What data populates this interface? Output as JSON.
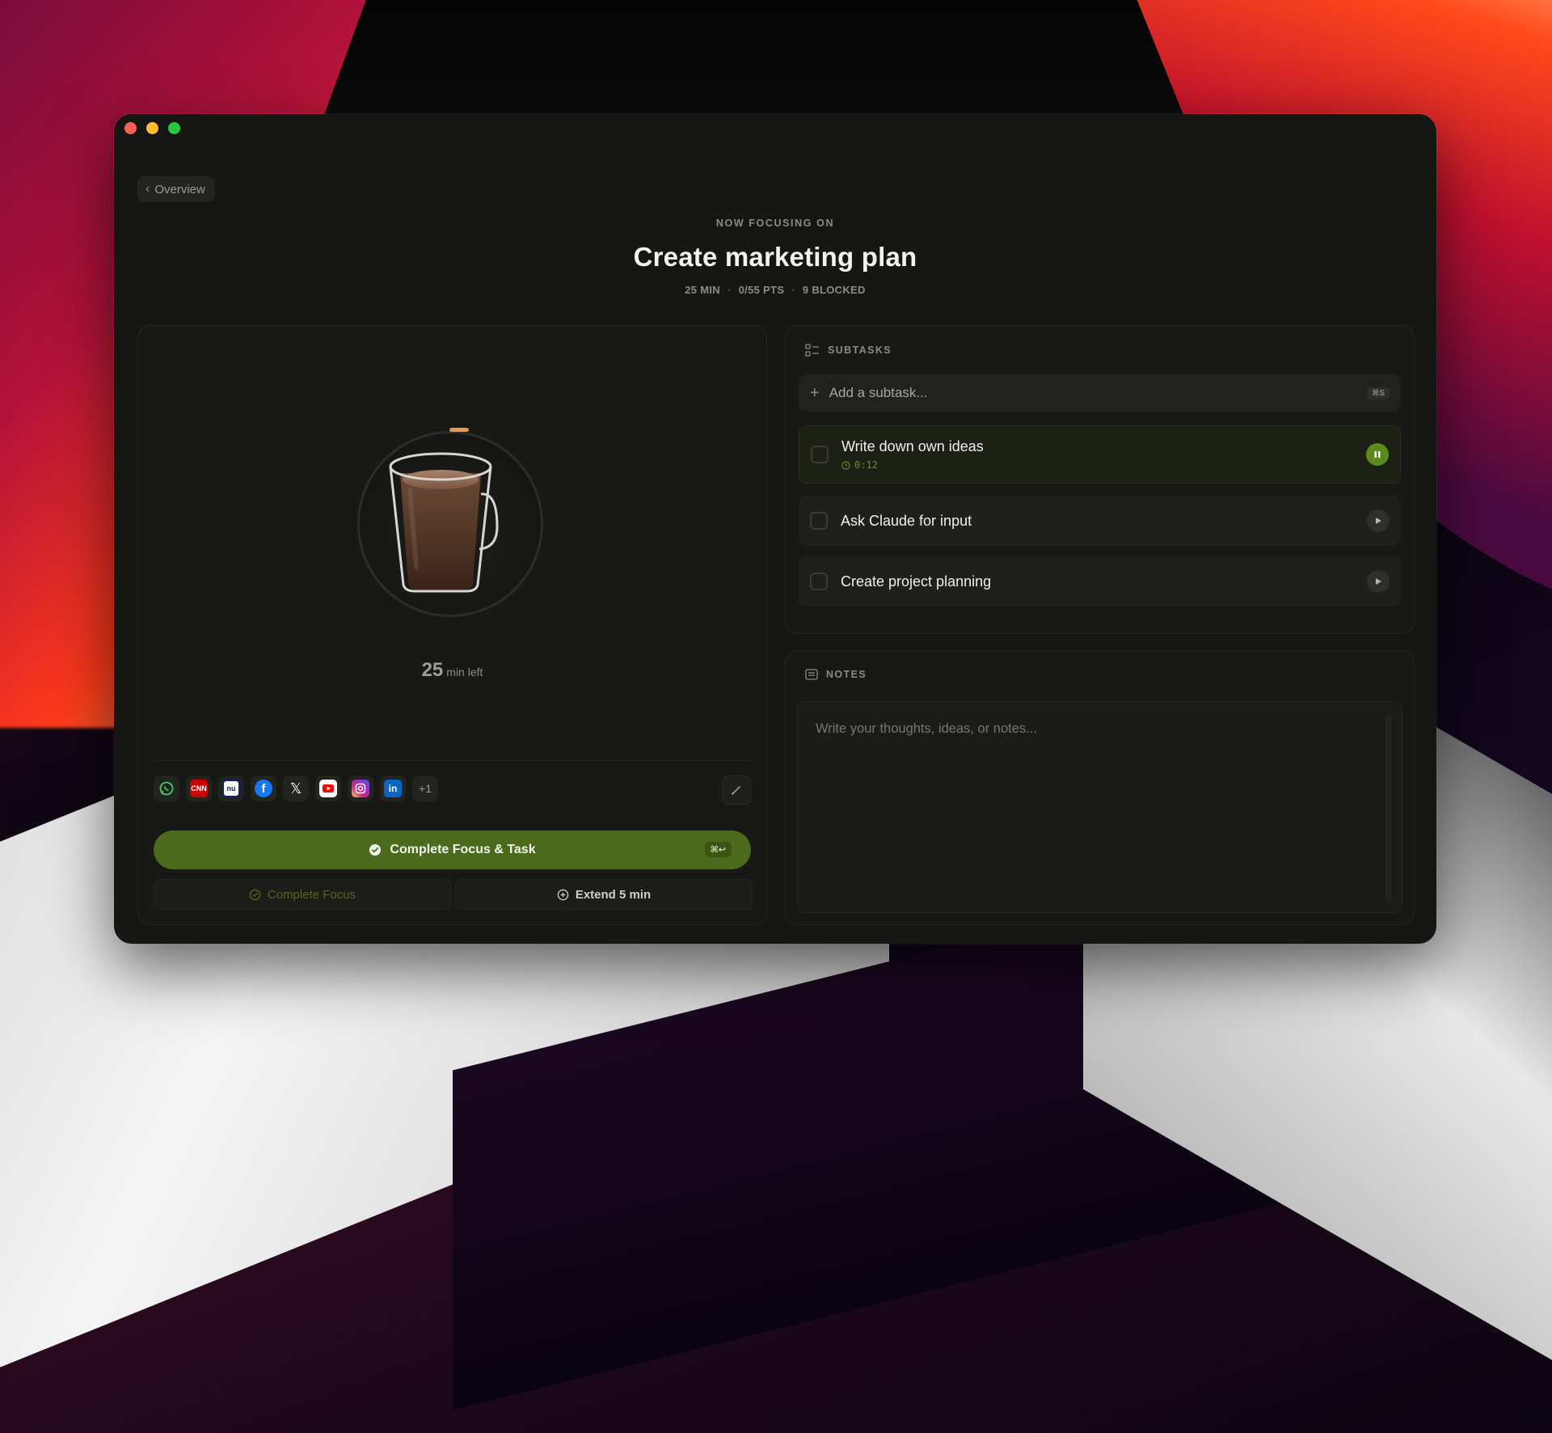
{
  "window": {
    "back_label": "Overview"
  },
  "focus": {
    "eyebrow": "NOW FOCUSING ON",
    "title": "Create marketing plan",
    "meta": [
      "25 MIN",
      "0/55 PTS",
      "9 BLOCKED"
    ]
  },
  "timer": {
    "minutes": "25",
    "label": "min left"
  },
  "blocked_apps": {
    "icons": [
      "whatsapp-icon",
      "cnn-icon",
      "nu-icon",
      "facebook-icon",
      "x-icon",
      "youtube-icon",
      "instagram-icon",
      "linkedin-icon"
    ],
    "glyphs": {
      "cnn": "CNN",
      "nu": "nu",
      "facebook": "f",
      "x": "𝕏",
      "linkedin": "in"
    },
    "more": "+1"
  },
  "actions": {
    "complete_task": "Complete Focus & Task",
    "complete_task_shortcut": "⌘↩",
    "complete_focus": "Complete Focus",
    "extend": "Extend 5 min"
  },
  "subtasks": {
    "header": "SUBTASKS",
    "add_placeholder": "Add a subtask...",
    "add_shortcut": "⌘S",
    "items": [
      {
        "name": "Write down own ideas",
        "timer": "0:12",
        "state": "running"
      },
      {
        "name": "Ask Claude for input",
        "state": "idle"
      },
      {
        "name": "Create project planning",
        "state": "idle"
      }
    ]
  },
  "notes": {
    "header": "NOTES",
    "placeholder": "Write your thoughts, ideas, or notes..."
  },
  "colors": {
    "accent_green": "#4c6a1c",
    "timer_ring_mark": "#e69a4a",
    "window_bg": "#161614"
  }
}
